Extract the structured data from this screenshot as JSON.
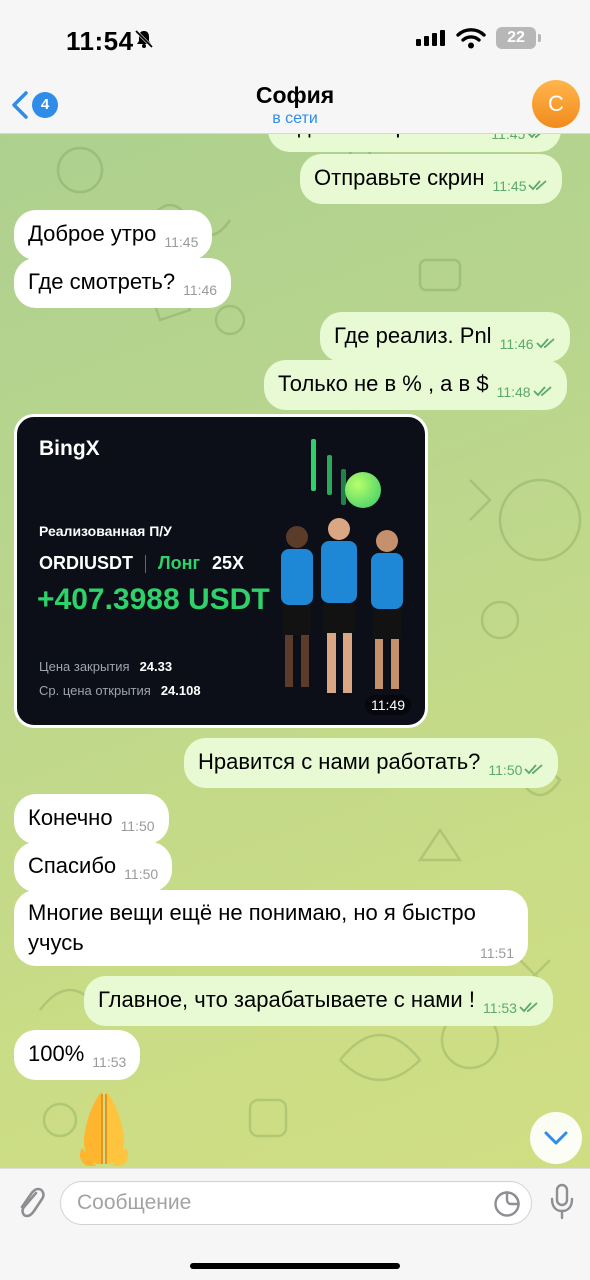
{
  "status_bar": {
    "time": "11:54",
    "battery": "22"
  },
  "header": {
    "back_count": "4",
    "title": "София",
    "status": "в сети",
    "avatar_letter": "С"
  },
  "messages": [
    {
      "text": "Сделка закрылась !",
      "time": "11:45",
      "dir": "out"
    },
    {
      "text": "Отправьте скрин",
      "time": "11:45",
      "dir": "out"
    },
    {
      "text": "Доброе утро",
      "time": "11:45",
      "dir": "in"
    },
    {
      "text": "Где смотреть?",
      "time": "11:46",
      "dir": "in"
    },
    {
      "text": "Где реализ. Pnl",
      "time": "11:46",
      "dir": "out"
    },
    {
      "text": "Только не в % , а в $",
      "time": "11:48",
      "dir": "out"
    },
    {
      "text": "Нравится с нами работать?",
      "time": "11:50",
      "dir": "out"
    },
    {
      "text": "Конечно",
      "time": "11:50",
      "dir": "in"
    },
    {
      "text": "Спасибо",
      "time": "11:50",
      "dir": "in"
    },
    {
      "text_line1": "Многие вещи ещё не понимаю, но я быстро",
      "text_line2": "учусь",
      "time": "11:51",
      "dir": "in"
    },
    {
      "text": "Главное, что зарабатываете с нами !",
      "time": "11:53",
      "dir": "out"
    },
    {
      "text": "100%",
      "time": "11:53",
      "dir": "in"
    }
  ],
  "image_message": {
    "brand": "BingX",
    "pnl_label": "Реализованная П/У",
    "pair": "ORDIUSDT",
    "side": "Лонг",
    "leverage": "25X",
    "pnl_value": "+407.3988 USDT",
    "close_price_label": "Цена закрытия",
    "close_price": "24.33",
    "open_price_label": "Ср. цена открытия",
    "open_price": "24.108",
    "time": "11:49"
  },
  "emoji_message": {
    "emoji": "folded-hands"
  },
  "composer": {
    "placeholder": "Сообщение"
  },
  "colors": {
    "accent": "#2f8ce8",
    "outgoing_bubble": "#e7fad4",
    "profit_green": "#2fd16a"
  }
}
